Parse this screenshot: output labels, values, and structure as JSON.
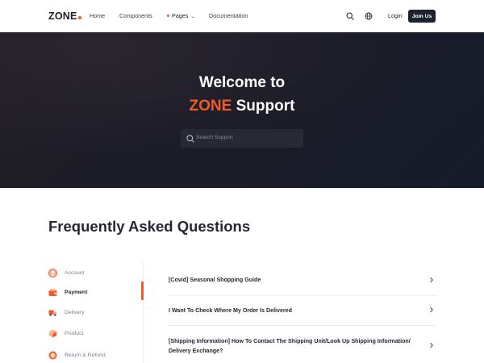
{
  "brand": {
    "name": "ZONE",
    "accent": "#f05a28"
  },
  "nav": {
    "links": [
      "Home",
      "Components",
      "Pages",
      "Documentation"
    ],
    "login": "Login",
    "join": "Join Us"
  },
  "hero": {
    "title_line1": "Welcome to",
    "title_accent": "ZONE",
    "title_rest": "Support",
    "search_placeholder": "Search Support"
  },
  "faq": {
    "title": "Frequently Asked Questions",
    "categories": [
      {
        "label": "Account",
        "icon": "account-icon",
        "active": false
      },
      {
        "label": "Payment",
        "icon": "wallet-icon",
        "active": true
      },
      {
        "label": "Delivery",
        "icon": "truck-icon",
        "active": false
      },
      {
        "label": "Product",
        "icon": "box-icon",
        "active": false
      },
      {
        "label": "Return & Refund",
        "icon": "refund-icon",
        "active": false
      }
    ],
    "questions": [
      "[Covid] Seasonal Shopping Guide",
      "I Want To Check Where My Order Is Delivered",
      "[Shipping Information] How To Contact The Shipping Unit/Look Up Shipping Information/ Delivery Exchange?"
    ]
  }
}
